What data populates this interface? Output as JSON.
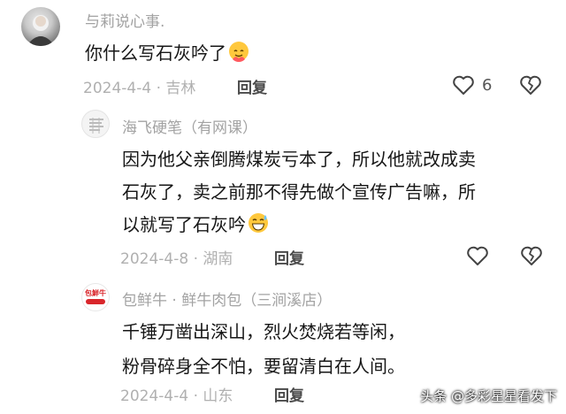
{
  "comments": [
    {
      "username": "与莉说心事.",
      "text_lines": [
        "你什么写石灰吟了"
      ],
      "emoji": "hug-emoji",
      "date_location": "2024-4-4 · 吉林",
      "reply_label": "回复",
      "like_count": "6"
    },
    {
      "username": "海飞硬笔（有网课）",
      "text_lines": [
        "因为他父亲倒腾煤炭亏本了，所以他就改成卖",
        "石灰了，卖之前那不得先做个宣传广告嘛，所",
        "以就写了石灰吟"
      ],
      "emoji": "grin-sweat-emoji",
      "date_location": "2024-4-8 · 湖南",
      "reply_label": "回复"
    },
    {
      "username": "包鲜牛 · 鲜牛肉包（三涧溪店）",
      "avatar_text": "包鮮牛",
      "text_lines": [
        "千锤万凿出深山，烈火焚烧若等闲，",
        "粉骨碎身全不怕，要留清白在人间。"
      ],
      "date_location": "2024-4-4 · 山东",
      "reply_label": "回复"
    }
  ],
  "watermark": "头条 @多彩星星看发下",
  "colors": {
    "muted": "#a3a3a3",
    "brand_red": "#d9262b",
    "text": "#161616"
  }
}
